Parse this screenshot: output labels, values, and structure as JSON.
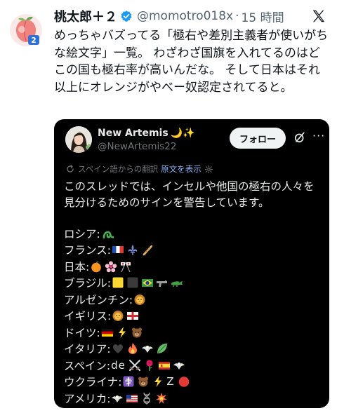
{
  "post": {
    "author_name": "桃太郎＋２",
    "handle": "@momotro018x",
    "separator": "·",
    "time": "15 時間",
    "text": "めっちゃバズってる「極右や差別主義者が使いがちな絵文字」一覧。 わざわざ国旗を入れてるのはどこの国も極右率が高いんだな。 そして日本はそれ以上にオレンジがやべー奴認定されてると。",
    "avatar_badge": "2"
  },
  "quote": {
    "name": "New Artemis",
    "name_emoji": "🌙✨",
    "handle": "@NewArtemis22",
    "follow_label": "フォロー",
    "more_label": "···",
    "translated_from": "スペイン語からの翻訳",
    "show_original": "原文を表示",
    "text": "このスレッドでは、インセルや他国の極右の人々を見分けるためのサインを警告しています。",
    "signs": [
      {
        "label": "ロシア:",
        "emoji": [
          "snake-loop"
        ]
      },
      {
        "label": "フランス:",
        "emoji": [
          "flag-france",
          "fleur-de-lis",
          "baguette"
        ]
      },
      {
        "label": "日本:",
        "emoji": [
          "orange",
          "cherry-blossom",
          "crossed-flags"
        ]
      },
      {
        "label": "ブラジル:",
        "emoji": [
          "yellow-square",
          "black-square",
          "flag-brazil",
          "pistol",
          "crocodile"
        ]
      },
      {
        "label": "アルゼンチン:",
        "emoji": [
          "lion"
        ]
      },
      {
        "label": "イギリス:",
        "emoji": [
          "lion",
          "flag-england"
        ]
      },
      {
        "label": "ドイツ:",
        "emoji": [
          "flag-germany",
          "lightning",
          "bear"
        ]
      },
      {
        "label": "イタリア:",
        "emoji": [
          "black-heart",
          "fire",
          "eagle",
          "leaf"
        ]
      },
      {
        "label": "スペイン:",
        "text": "de",
        "emoji": [
          "crossed-swords",
          "rose",
          "flag-spain",
          "eagle"
        ]
      },
      {
        "label": "ウクライナ:",
        "emoji": [
          "orthodox-cross",
          "bear",
          "lightning"
        ],
        "text_after": "Z",
        "emoji_after": [
          "red-circle"
        ]
      },
      {
        "label": "アメリカ:",
        "emoji": [
          "eagle",
          "flag-usa",
          "dna",
          "explosion"
        ]
      }
    ]
  },
  "icons": {
    "verified": "verified-badge-icon",
    "x_logo": "x-logo-icon",
    "grok": "grok-icon",
    "translate": "translate-icon",
    "settings": "gear-icon"
  },
  "colors": {
    "verified_blue": "#1d9bf0",
    "link_blue": "#8ab4f8",
    "card_bg": "#000000",
    "muted": "#71767b"
  }
}
